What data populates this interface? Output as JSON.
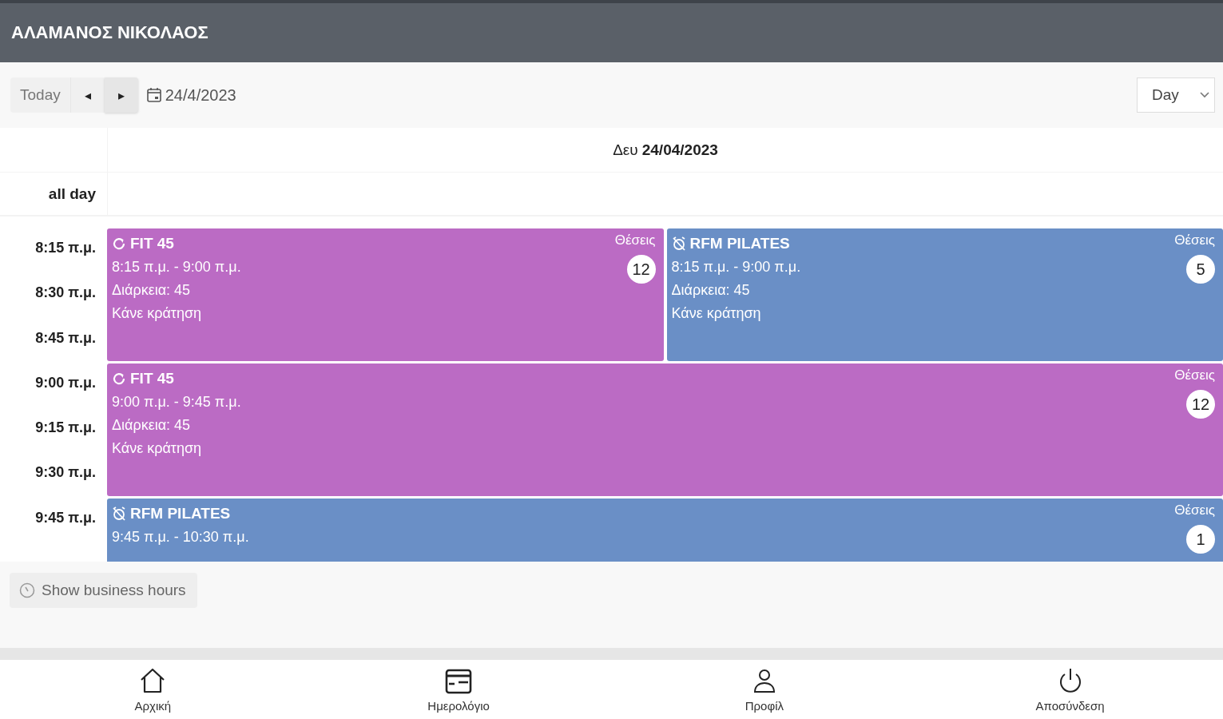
{
  "header": {
    "title": "ΑΛΑΜΑΝΟΣ ΝΙΚΟΛΑΟΣ"
  },
  "toolbar": {
    "today": "Today",
    "prev": "◂",
    "next": "▸",
    "date": "24/4/2023",
    "view": "Day"
  },
  "day_header": {
    "weekday": "Δευ",
    "date": "24/04/2023"
  },
  "all_day_label": "all day",
  "time_slots": [
    "8:15 π.μ.",
    "8:30 π.μ.",
    "8:45 π.μ.",
    "9:00 π.μ.",
    "9:15 π.μ.",
    "9:30 π.μ.",
    "9:45 π.μ."
  ],
  "event_rows": [
    [
      {
        "kind": "repeat",
        "title": "FIT 45",
        "time": "8:15 π.μ. - 9:00 π.μ.",
        "duration": "Διάρκεια: 45",
        "action": "Κάνε κράτηση",
        "seats_label": "Θέσεις",
        "seats": "12",
        "color": "#bb6bc4"
      },
      {
        "kind": "alarm",
        "title": "RFM PILATES",
        "time": "8:15 π.μ. - 9:00 π.μ.",
        "duration": "Διάρκεια: 45",
        "action": "Κάνε κράτηση",
        "seats_label": "Θέσεις",
        "seats": "5",
        "color": "#6a8fc6"
      }
    ],
    [
      {
        "kind": "repeat",
        "title": "FIT 45",
        "time": "9:00 π.μ. - 9:45 π.μ.",
        "duration": "Διάρκεια: 45",
        "action": "Κάνε κράτηση",
        "seats_label": "Θέσεις",
        "seats": "12",
        "color": "#bb6bc4"
      }
    ],
    [
      {
        "kind": "alarm",
        "title": "RFM PILATES",
        "time": "9:45 π.μ. - 10:30 π.μ.",
        "seats_label": "Θέσεις",
        "seats": "1",
        "color": "#6a8fc6"
      }
    ]
  ],
  "business_hours_button": "Show business hours",
  "nav": [
    {
      "kind": "home",
      "label": "Αρχική"
    },
    {
      "kind": "calendar",
      "label": "Ημερολόγιο"
    },
    {
      "kind": "profile",
      "label": "Προφίλ"
    },
    {
      "kind": "logout",
      "label": "Αποσύνδεση"
    }
  ]
}
